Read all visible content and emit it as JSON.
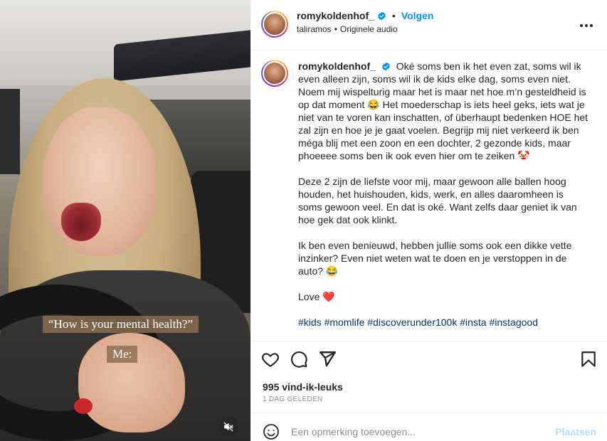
{
  "media": {
    "overlay_question": "“How is your mental health?”",
    "overlay_answer": "Me:"
  },
  "header": {
    "username": "romykoldenhof_",
    "separator": "•",
    "follow_label": "Volgen",
    "audio_author": "taliramos",
    "audio_separator": "•",
    "audio_label": "Originele audio"
  },
  "caption": {
    "username": "romykoldenhof_",
    "paragraph1": "Oké soms ben ik het even zat, soms wil ik even alleen zijn, soms wil ik de kids elke dag, soms even niet. Noem mij wispelturig maar het is maar net hoe m’n gesteldheid is op dat moment 😂 Het moederschap is iets heel geks, iets wat je niet van te voren kan inschatten, of überhaupt bedenken HOE het zal zijn en hoe je je gaat voelen. Begrijp mij niet verkeerd ik ben méga blij met een zoon en een dochter, 2 gezonde kids, maar phoeeee soms ben ik ook even hier om te zeiken 🤡",
    "paragraph2": "Deze 2 zijn de liefste voor mij, maar gewoon alle ballen hoog houden, het huishouden, kids, werk, en alles daaromheen is soms gewoon veel. En dat is oké. Want zelfs daar geniet ik van hoe gek dat ook klinkt.",
    "paragraph3": "Ik ben even benieuwd, hebben jullie soms ook een dikke vette inzinker? Even niet weten wat te doen en je verstoppen in de auto? 😂",
    "paragraph4": "Love ❤️",
    "hashtags": "#kids #momlife #discoverunder100k #insta #instagood"
  },
  "footer": {
    "likes": "995 vind-ik-leuks",
    "date": "1 DAG GELEDEN",
    "comment_placeholder": "Een opmerking toevoegen...",
    "post_label": "Plaatsen"
  },
  "colors": {
    "accent": "#0095f6",
    "post_disabled": "#b2dffc",
    "heart": "#e0245e"
  },
  "icons": [
    "verified-badge-icon",
    "more-options-icon",
    "heart-icon",
    "comment-icon",
    "share-icon",
    "bookmark-icon",
    "smiley-icon",
    "mute-icon"
  ]
}
